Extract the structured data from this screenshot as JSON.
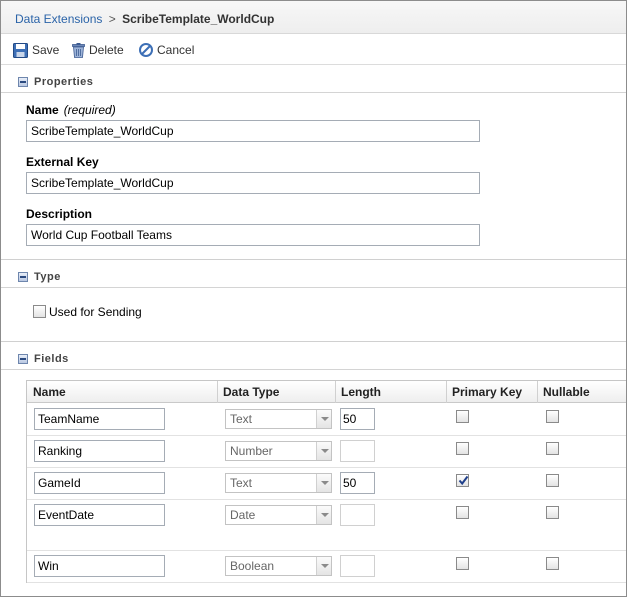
{
  "breadcrumb": {
    "link": "Data Extensions",
    "separator": ">",
    "current": "ScribeTemplate_WorldCup"
  },
  "toolbar": {
    "save_label": "Save",
    "delete_label": "Delete",
    "cancel_label": "Cancel"
  },
  "properties": {
    "section_title": "Properties",
    "name_label": "Name",
    "name_required": "(required)",
    "name_value": "ScribeTemplate_WorldCup",
    "external_key_label": "External Key",
    "external_key_value": "ScribeTemplate_WorldCup",
    "description_label": "Description",
    "description_value": "World Cup Football Teams"
  },
  "type": {
    "section_title": "Type",
    "used_for_sending_label": "Used for Sending",
    "used_for_sending": false
  },
  "fields": {
    "section_title": "Fields",
    "columns": [
      "Name",
      "Data Type",
      "Length",
      "Primary Key",
      "Nullable"
    ],
    "rows": [
      {
        "name": "TeamName",
        "data_type": "Text",
        "length": "50",
        "primary_key": false,
        "nullable": false
      },
      {
        "name": "Ranking",
        "data_type": "Number",
        "length": "",
        "primary_key": false,
        "nullable": false
      },
      {
        "name": "GameId",
        "data_type": "Text",
        "length": "50",
        "primary_key": true,
        "nullable": false
      },
      {
        "name": "EventDate",
        "data_type": "Date",
        "length": "",
        "primary_key": false,
        "nullable": false
      },
      {
        "name": "Win",
        "data_type": "Boolean",
        "length": "",
        "primary_key": false,
        "nullable": false
      }
    ]
  },
  "colors": {
    "link": "#2a63a8",
    "checkmark": "#1f3f8a"
  }
}
